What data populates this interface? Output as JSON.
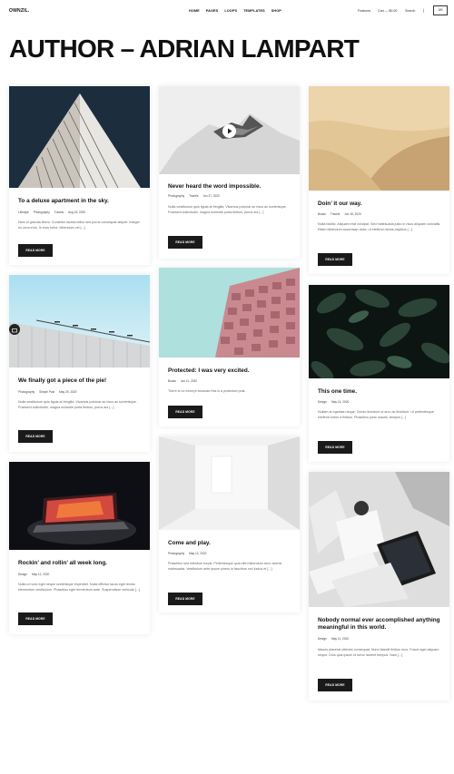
{
  "site": {
    "logo": "OWNZIL.",
    "nav": [
      "HOME",
      "PAGES",
      "LOOPS",
      "TEMPLATES",
      "SHOP"
    ],
    "features": "Features",
    "cart": "Cart — $0.00",
    "search": "Search",
    "divider": "|",
    "cart_button": "0/0"
  },
  "page_title": "AUTHOR – ADRIAN LAMPART",
  "read_more": "READ MORE",
  "posts": [
    {
      "title": "To a deluxe apartment in the sky.",
      "meta": [
        "Lifestyle",
        "Photography",
        "Travels",
        "Aug 15, 2020"
      ],
      "excerpt": "Nam id gravida libero. Curabitur lacinia tellus sed purus consequat aliquet. Integer eu urna eros. In eros tortor, bibendum vel [...]"
    },
    {
      "title": "We finally got a piece of the pie!",
      "meta": [
        "Photography",
        "Simple Post",
        "May 29, 2020"
      ],
      "excerpt": "Nulla vestibulum quis ligula at fringilla. Vivamus pulvinar ac risus ac scelerisque. Praesent sollicitudin, magna molestie porta finibus, purus dui [...]"
    },
    {
      "title": "Rockin’ and rollin’ all week long.",
      "meta": [
        "Design",
        "May 12, 2020"
      ],
      "excerpt": "Nulla ut nunc eget neque scelerisque imperdiet. Nulla efficitur lacus eget lectus elementum vestibulum. Phasellus eget fermentum ante. Suspendisse vehicula [...]"
    },
    {
      "title": "Never heard the word impossible.",
      "meta": [
        "Photography",
        "Travels",
        "Jun 27, 2020"
      ],
      "excerpt": "Nulla vestibulum quis ligula at fringilla. Vivamus pulvinar ac risus ac scelerisque. Praesent sollicitudin, magna molestie porta finibus, purus dui [...]"
    },
    {
      "title": "Protected: I was very excited.",
      "meta": [
        "Books",
        "Jun 11, 2020"
      ],
      "excerpt": "There is no excerpt because this is a protected post."
    },
    {
      "title": "Come and play.",
      "meta": [
        "Photography",
        "May 12, 2020"
      ],
      "excerpt": "Phasellus sed interdum turpis. Pellentesque quis nibh bibendum arcu viverra malesuada. Vestibulum ante ipsum primis in faucibus orci luctus et [...]"
    },
    {
      "title": "Doin’ it our way.",
      "meta": [
        "Books",
        "Travels",
        "Jun 15, 2020"
      ],
      "excerpt": "Nulla facilisi. Aliquam erat volutpat. Sed malesuada justo in risus aliquam convallis. Etiam bibendum accumsan dolor, ut eleifend metus dapibus [...]"
    },
    {
      "title": "This one time.",
      "meta": [
        "Design",
        "May 14, 2020"
      ],
      "excerpt": "Nullam at egestas neque. Donec tincidunt ut arcu ac tincidunt. Ut pellentesque eleifend lorem a finibus. Phasellus justo mauris, tempus [...]"
    },
    {
      "title": "Nobody normal ever accomplished anything meaningful in this world.",
      "meta": [
        "Design",
        "May 11, 2020"
      ],
      "excerpt": "Mauris placerat ultricies consequat. Nunc blandit finibus eros. Fusce eget aliquam neque. Duis quis ipsum id tortor laoreet tempus. Nam [...]"
    }
  ]
}
